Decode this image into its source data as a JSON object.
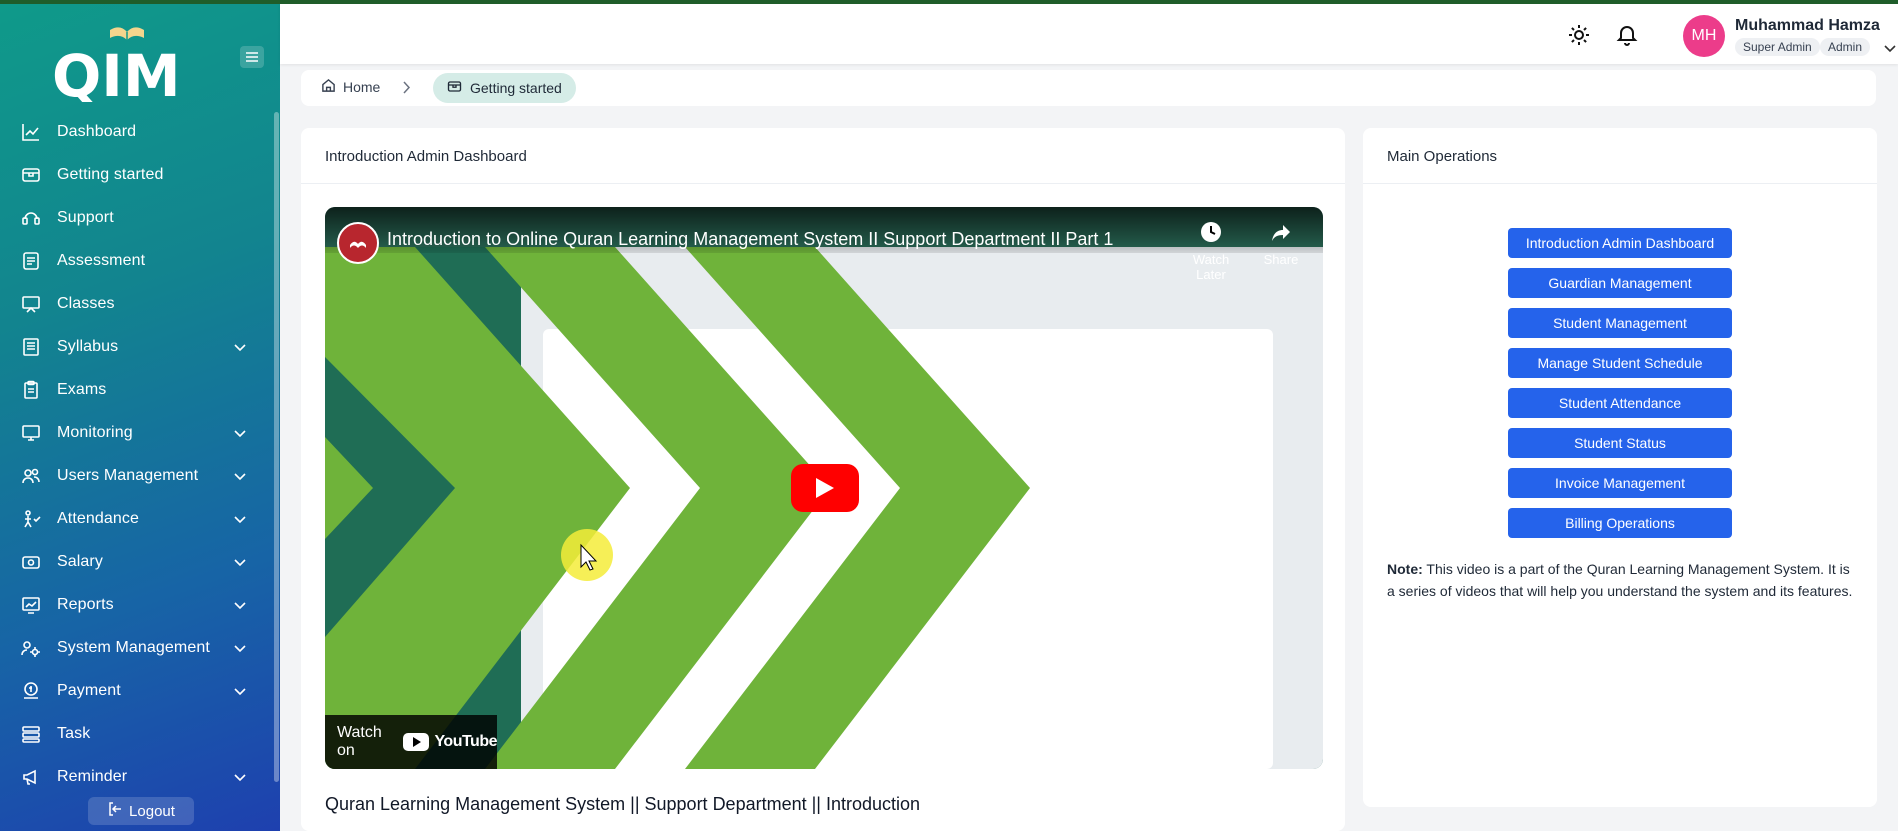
{
  "app": {
    "brand": "QIM"
  },
  "sidebar": {
    "items": [
      {
        "label": "Dashboard",
        "icon": "chart-line-icon",
        "has_children": false
      },
      {
        "label": "Getting started",
        "icon": "box-icon",
        "has_children": false
      },
      {
        "label": "Support",
        "icon": "support-icon",
        "has_children": false
      },
      {
        "label": "Assessment",
        "icon": "document-icon",
        "has_children": false
      },
      {
        "label": "Classes",
        "icon": "presentation-icon",
        "has_children": false
      },
      {
        "label": "Syllabus",
        "icon": "book-icon",
        "has_children": true
      },
      {
        "label": "Exams",
        "icon": "clipboard-icon",
        "has_children": false
      },
      {
        "label": "Monitoring",
        "icon": "monitor-icon",
        "has_children": true
      },
      {
        "label": "Users Management",
        "icon": "users-icon",
        "has_children": true
      },
      {
        "label": "Attendance",
        "icon": "attendance-icon",
        "has_children": true
      },
      {
        "label": "Salary",
        "icon": "salary-icon",
        "has_children": true
      },
      {
        "label": "Reports",
        "icon": "reports-icon",
        "has_children": true
      },
      {
        "label": "System Management",
        "icon": "settings-users-icon",
        "has_children": true
      },
      {
        "label": "Payment",
        "icon": "payment-icon",
        "has_children": true
      },
      {
        "label": "Task",
        "icon": "task-icon",
        "has_children": false
      },
      {
        "label": "Reminder",
        "icon": "megaphone-icon",
        "has_children": true
      }
    ],
    "logout_label": "Logout"
  },
  "header": {
    "user": {
      "initials": "MH",
      "name": "Muhammad Hamza",
      "roles": [
        "Super Admin",
        "Admin"
      ]
    }
  },
  "breadcrumb": {
    "home": "Home",
    "current": "Getting started"
  },
  "video_card": {
    "title": "Introduction Admin Dashboard",
    "video_title": "Introduction to Online Quran Learning Management System II Support Department II Part 1",
    "watch_later": "Watch Later",
    "share": "Share",
    "watch_on": "Watch on",
    "youtube": "YouTube",
    "caption": "Quran Learning Management System || Support Department || Introduction"
  },
  "operations_card": {
    "title": "Main Operations",
    "buttons": [
      "Introduction Admin Dashboard",
      "Guardian Management",
      "Student Management",
      "Manage Student Schedule",
      "Student Attendance",
      "Student Status",
      "Invoice Management",
      "Billing Operations"
    ],
    "note_label": "Note:",
    "note_text": " This video is a part of the Quran Learning Management System. It is a series of videos that will help you understand the system and its features."
  },
  "colors": {
    "accent": "#2563eb",
    "avatar": "#ec3c8a",
    "sidebar_start": "#0f9a8a",
    "sidebar_end": "#1e40af",
    "breadcrumb_active_bg": "#d5ece7",
    "video_chevrons": "#6fb33a"
  }
}
